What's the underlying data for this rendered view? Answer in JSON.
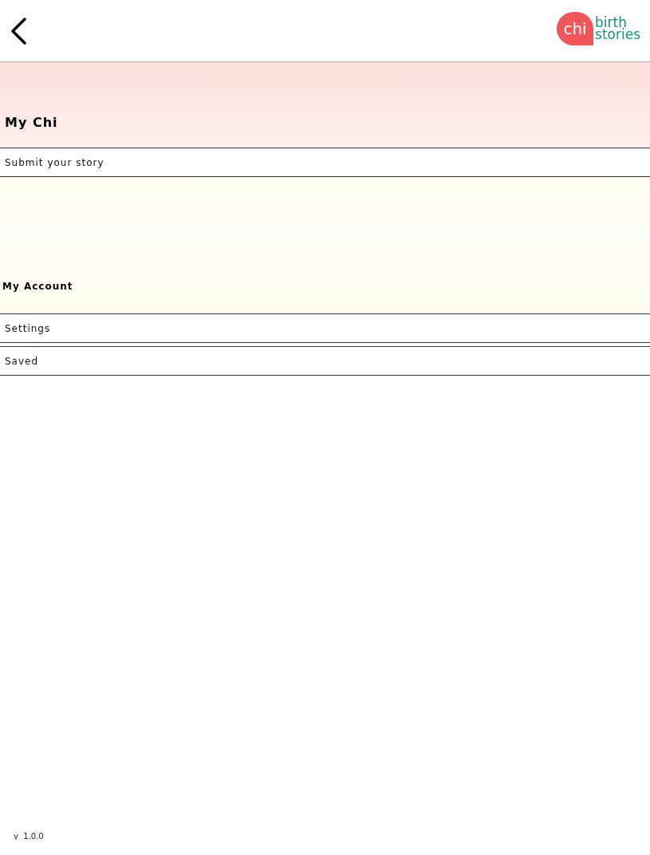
{
  "header": {
    "logo": {
      "mark": "chi",
      "line_1": "birth",
      "line_2": "stories"
    }
  },
  "sections": [
    {
      "title": "My Chi",
      "color": "#fde0de",
      "items": [
        "Submit your story"
      ]
    },
    {
      "title": "My Account",
      "color": "#fffdf0",
      "items": [
        "Settings",
        "Saved"
      ]
    }
  ],
  "version": "v  1.0.0"
}
